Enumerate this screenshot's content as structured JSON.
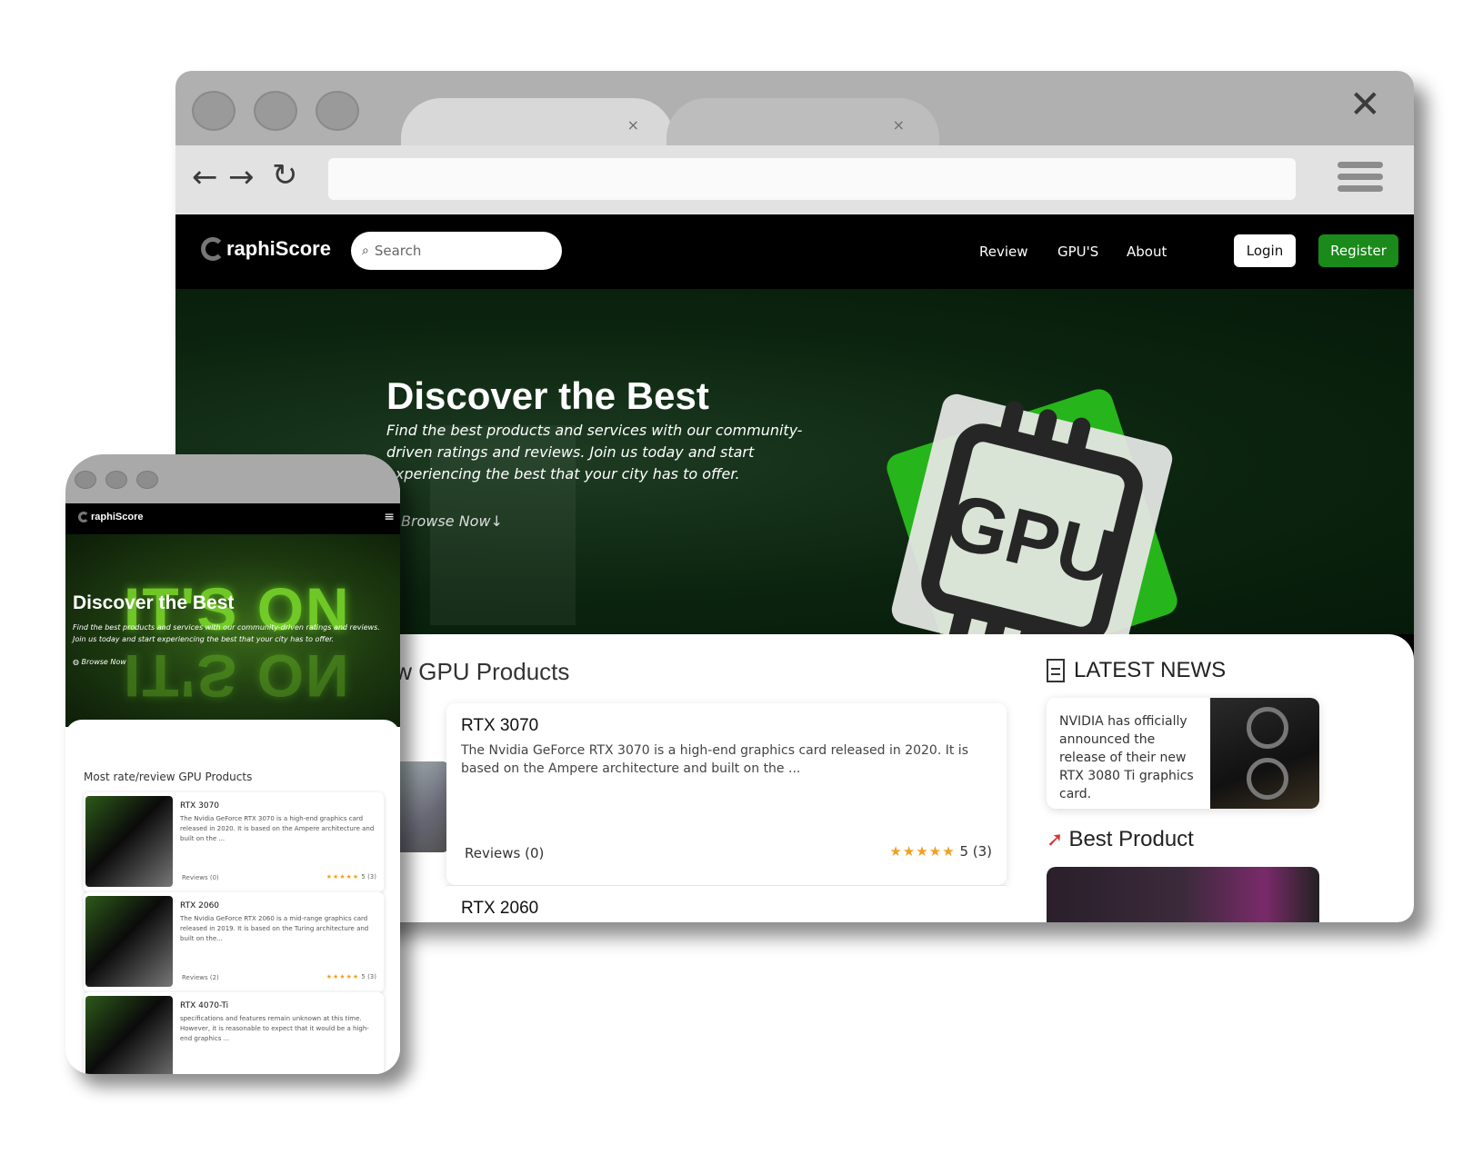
{
  "desktop": {
    "nav": {
      "brand": "raphiScore",
      "search_placeholder": "Search",
      "links": [
        "Review",
        "GPU'S",
        "About"
      ],
      "login": "Login",
      "register": "Register"
    },
    "hero": {
      "title": "Discover the Best",
      "text": "Find the best products and services with our community-driven ratings and reviews. Join us today and start experiencing the best that your city has to offer.",
      "cta": "Browse Now↓",
      "art_text": "GPU"
    },
    "products": {
      "section_title": "view GPU Products",
      "items": [
        {
          "name": "RTX 3070",
          "desc": "The Nvidia GeForce RTX 3070 is a high-end graphics card released in 2020. It is based on the Ampere architecture and built on the ...",
          "reviews": "Reviews (0)",
          "stars": "★★★★★",
          "rating": "5 (3)"
        },
        {
          "name": "RTX 2060"
        }
      ]
    },
    "news": {
      "title": "LATEST NEWS",
      "item": "NVIDIA has officially announced the release of their new RTX 3080 Ti graphics card."
    },
    "best": {
      "title": "Best Product"
    }
  },
  "mobile": {
    "brand": "raphiScore",
    "hero_title": "Discover the Best",
    "hero_bg_text": "IT'S ON",
    "hero_text": "Find the best products and services with our community-driven ratings and reviews. Join us today and start experiencing the best that your city has to offer.",
    "cta": "Browse Now",
    "section_title": "Most rate/review GPU Products",
    "items": [
      {
        "name": "RTX 3070",
        "desc": "The Nvidia GeForce RTX 3070 is a high-end graphics card released in 2020. It is based on the Ampere architecture and built on the ...",
        "reviews": "Reviews (0)",
        "stars": "★★★★★",
        "rating": "5 (3)"
      },
      {
        "name": "RTX 2060",
        "desc": "The Nvidia GeForce RTX 2060 is a mid-range graphics card released in 2019. It is based on the Turing architecture and built on the...",
        "reviews": "Reviews (2)",
        "stars": "★★★★★",
        "rating": "5 (3)"
      },
      {
        "name": "RTX 4070-Ti",
        "desc": "specifications and features remain unknown at this time. However, it is reasonable to expect that it would be a high-end graphics ..."
      }
    ]
  },
  "colors": {
    "accent_green": "#1a8a1a",
    "hero_green": "#0b240f",
    "star": "#f0a020"
  }
}
